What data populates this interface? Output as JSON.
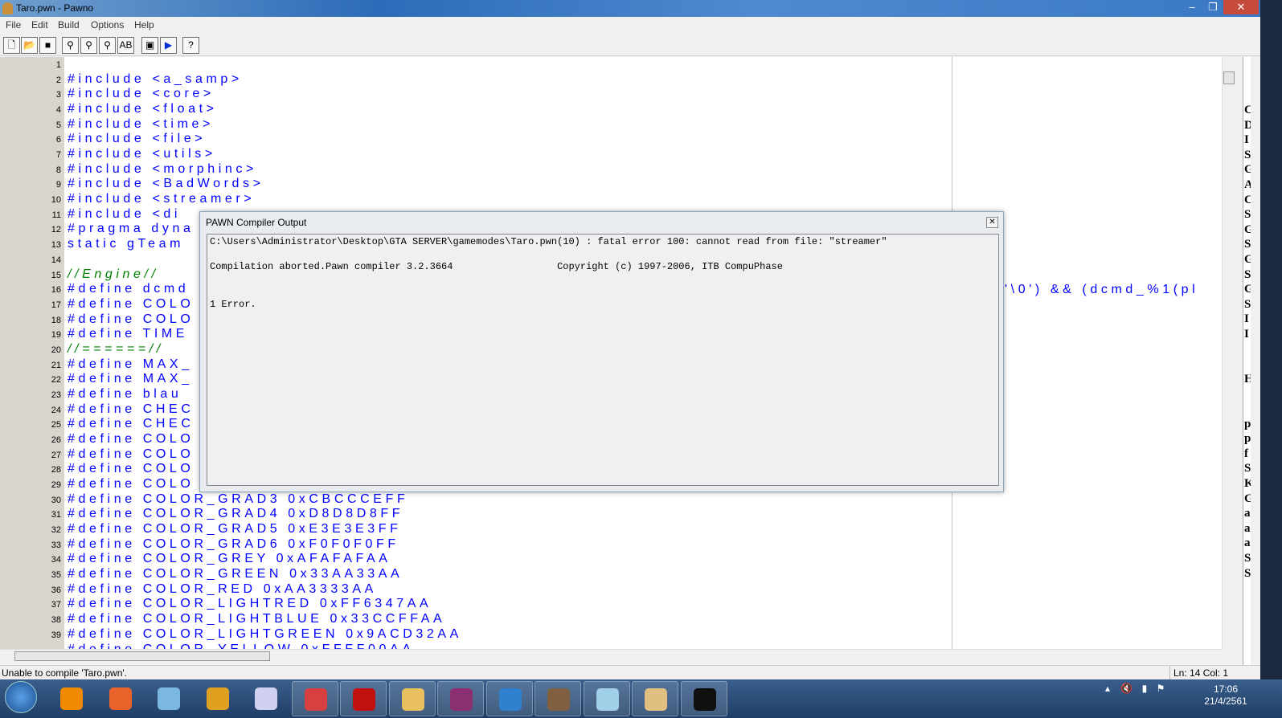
{
  "window": {
    "title": "Taro.pwn - Pawno",
    "minimize": "–",
    "maximize": "❐",
    "close": "✕"
  },
  "menu": [
    "File",
    "Edit",
    "Build",
    "Options",
    "Help"
  ],
  "toolbar": [
    {
      "icon": "new-file-icon",
      "g": "🗋"
    },
    {
      "icon": "open-folder-icon",
      "g": "📂"
    },
    {
      "icon": "save-icon",
      "g": "■"
    },
    {
      "icon": "find-icon",
      "g": "⚲"
    },
    {
      "icon": "find-next-icon",
      "g": "⚲"
    },
    {
      "icon": "find-prev-icon",
      "g": "⚲"
    },
    {
      "icon": "replace-icon",
      "g": "AB"
    },
    {
      "icon": "compile-icon",
      "g": "▣"
    },
    {
      "icon": "run-icon",
      "g": "▶"
    },
    {
      "icon": "help-icon",
      "g": "?"
    }
  ],
  "code": [
    {
      "n": "1",
      "t": ""
    },
    {
      "n": "2",
      "t": "#include <a_samp>"
    },
    {
      "n": "3",
      "t": "#include <core>"
    },
    {
      "n": "4",
      "t": "#include <float>"
    },
    {
      "n": "5",
      "t": "#include <time>"
    },
    {
      "n": "6",
      "t": "#include <file>"
    },
    {
      "n": "7",
      "t": "#include <utils>"
    },
    {
      "n": "8",
      "t": "#include <morphinc>"
    },
    {
      "n": "9",
      "t": "#include <BadWords>"
    },
    {
      "n": "10",
      "t": "#include <streamer>"
    },
    {
      "n": "11",
      "t": "#include <di"
    },
    {
      "n": "12",
      "t": "#pragma dyna"
    },
    {
      "n": "13",
      "t": "static gTeam"
    },
    {
      "n": "14",
      "t": ""
    },
    {
      "n": "15",
      "t": "//Engine//",
      "c": true
    },
    {
      "n": "16",
      "t": "#define dcmd"
    },
    {
      "n": "17",
      "t": "#define COLO"
    },
    {
      "n": "18",
      "t": "#define COLO"
    },
    {
      "n": "19",
      "t": "#define TIME"
    },
    {
      "n": "20",
      "t": "//======//",
      "c": true
    },
    {
      "n": "21",
      "t": "#define MAX_"
    },
    {
      "n": "22",
      "t": "#define MAX_"
    },
    {
      "n": "23",
      "t": "#define blau"
    },
    {
      "n": "24",
      "t": "#define CHEC"
    },
    {
      "n": "25",
      "t": "#define CHEC"
    },
    {
      "n": "26",
      "t": "#define COLO"
    },
    {
      "n": "27",
      "t": "#define COLO"
    },
    {
      "n": "28",
      "t": "#define COLO"
    },
    {
      "n": "29",
      "t": "#define COLO"
    },
    {
      "n": "30",
      "t": "#define COLOR_GRAD3 0xCBCCCEFF"
    },
    {
      "n": "31",
      "t": "#define COLOR_GRAD4 0xD8D8D8FF"
    },
    {
      "n": "32",
      "t": "#define COLOR_GRAD5 0xE3E3E3FF"
    },
    {
      "n": "33",
      "t": "#define COLOR_GRAD6 0xF0F0F0FF"
    },
    {
      "n": "34",
      "t": "#define COLOR_GREY 0xAFAFAFAA"
    },
    {
      "n": "35",
      "t": "#define COLOR_GREEN 0x33AA33AA"
    },
    {
      "n": "36",
      "t": "#define COLOR_RED 0xAA3333AA"
    },
    {
      "n": "37",
      "t": "#define COLOR_LIGHTRED 0xFF6347AA"
    },
    {
      "n": "38",
      "t": "#define COLOR_LIGHTBLUE 0x33CCFFAA"
    },
    {
      "n": "39",
      "t": "#define COLOR_LIGHTGREEN 0x9ACD32AA"
    },
    {
      "n": "",
      "t": "#define COLOR_YELLOW 0xFFFF00AA"
    }
  ],
  "line16_tail": "'\\0') && (dcmd_%1(pl",
  "side_panel": [
    "C",
    "D",
    "I",
    "S",
    "G",
    "A",
    "C",
    "S",
    "G",
    "S",
    "G",
    "S",
    "G",
    "S",
    "I",
    "I",
    "",
    "",
    "H",
    "",
    "",
    "p",
    "p",
    "f",
    "S",
    "K",
    "G",
    "a",
    "a",
    "a",
    "S",
    "S"
  ],
  "dialog": {
    "title": "PAWN Compiler Output",
    "close": "✕",
    "lines": [
      "C:\\Users\\Administrator\\Desktop\\GTA SERVER\\gamemodes\\Taro.pwn(10) : fatal error 100: cannot read from file: \"streamer\"",
      "Compilation aborted.Pawn compiler 3.2.3664                  Copyright (c) 1997-2006, ITB CompuPhase",
      "1 Error."
    ]
  },
  "status": {
    "message": "Unable to compile 'Taro.pwn'.",
    "position": "Ln: 14   Col: 1"
  },
  "taskbar": {
    "apps": [
      {
        "name": "vlc",
        "color": "#f08a00"
      },
      {
        "name": "app-orange",
        "color": "#e8622a"
      },
      {
        "name": "pinwheel",
        "color": "#7ab8e0"
      },
      {
        "name": "chrome",
        "color": "#e0a020"
      },
      {
        "name": "grid-app",
        "color": "#d0d0f0"
      },
      {
        "name": "snipping-tool",
        "color": "#d84040"
      },
      {
        "name": "garena",
        "color": "#c01010"
      },
      {
        "name": "explorer",
        "color": "#e8c060"
      },
      {
        "name": "winrar",
        "color": "#8a3070"
      },
      {
        "name": "circle-app",
        "color": "#3080d0"
      },
      {
        "name": "gta-sa",
        "color": "#806040"
      },
      {
        "name": "notepad",
        "color": "#a0d0e8"
      },
      {
        "name": "samp",
        "color": "#e0c080"
      },
      {
        "name": "cmd",
        "color": "#101010"
      }
    ],
    "time": "17:06",
    "date": "21/4/2561"
  },
  "colors": {
    "code": "#0000ff",
    "comment": "#008000",
    "gutter": "#d8d5cd"
  }
}
